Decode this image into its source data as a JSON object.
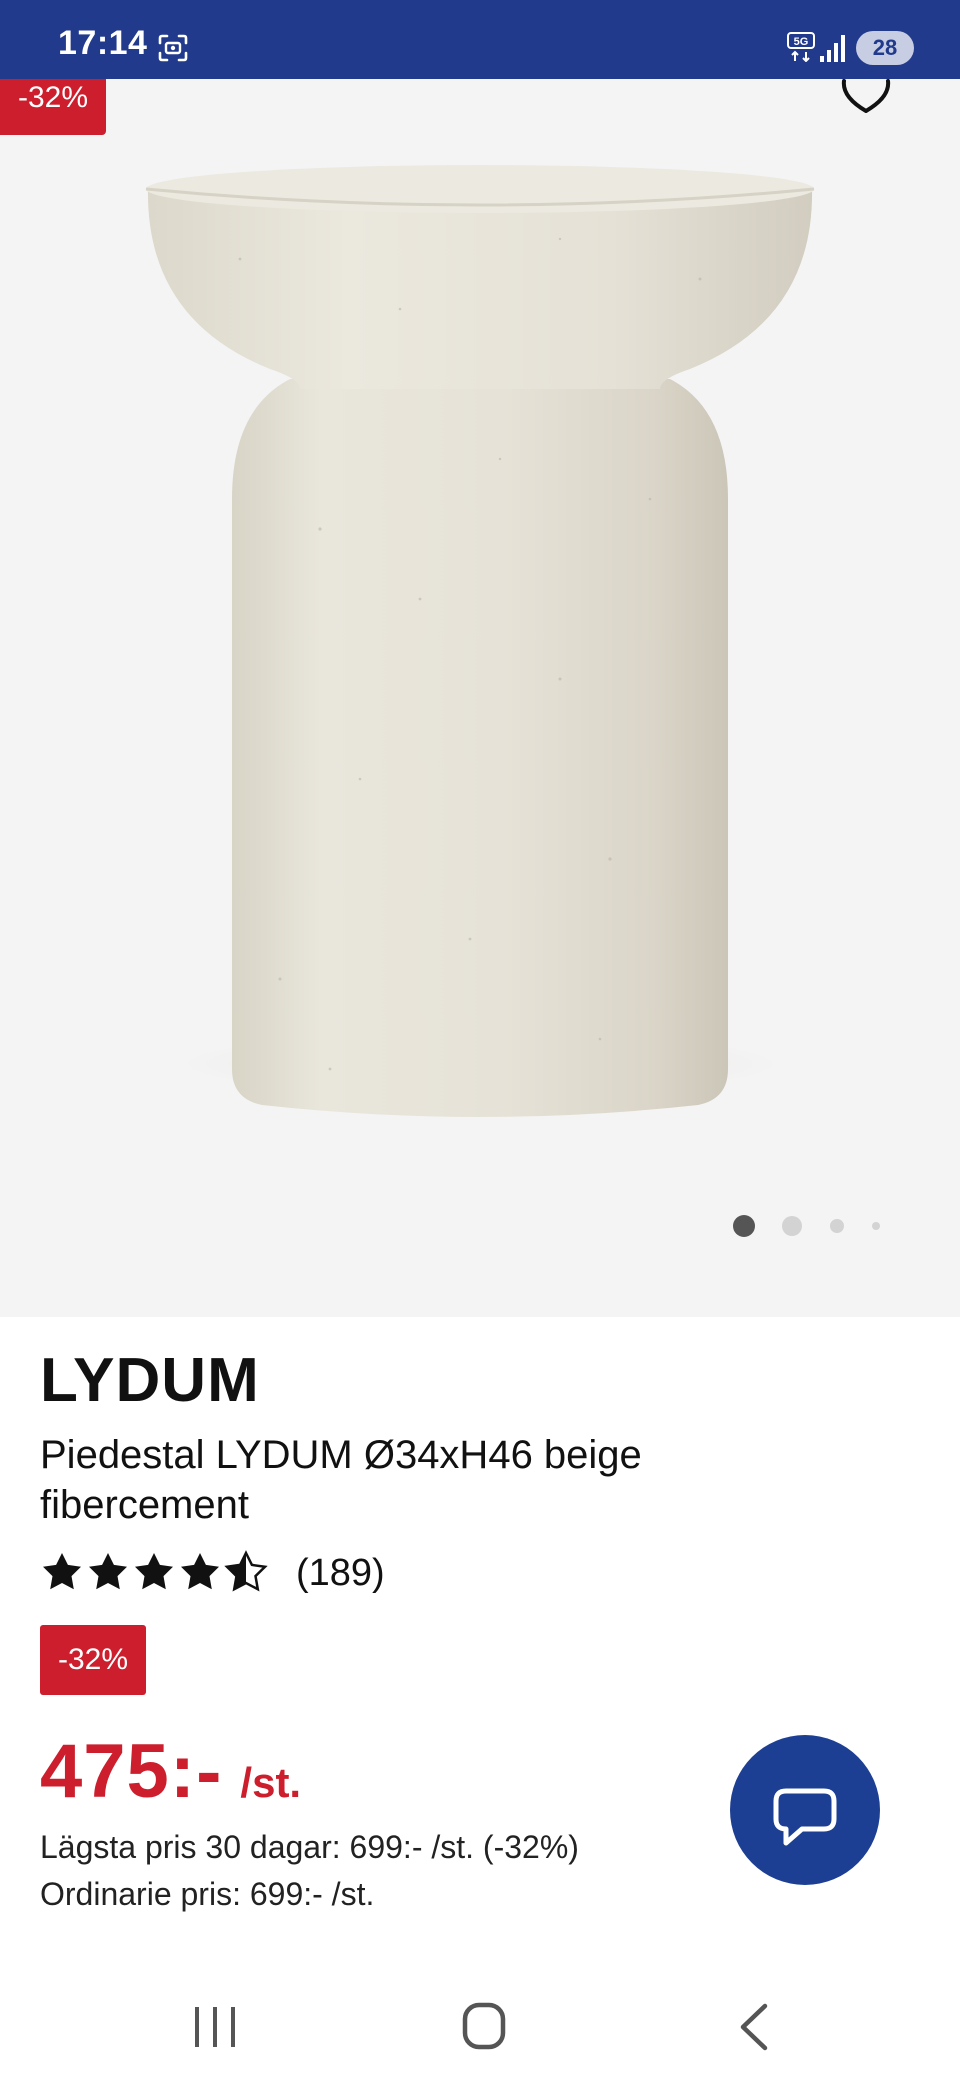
{
  "status_bar": {
    "time": "17:14",
    "battery": "28",
    "icons": [
      "screenshot-icon",
      "5g-network-icon",
      "signal-icon",
      "battery-icon"
    ]
  },
  "gallery": {
    "discount_badge": "-32%",
    "favorite_icon": "heart-outline-icon",
    "page_count": 4,
    "active_page": 1
  },
  "product": {
    "brand": "LYDUM",
    "title": "Piedestal LYDUM Ø34xH46 beige fibercement",
    "rating": 4.5,
    "rating_max": 5,
    "review_count": "(189)",
    "discount_badge": "-32%",
    "price": "475:-",
    "price_unit": "/st.",
    "lowest_price_text": "Lägsta pris 30 dagar: 699:- /st. (-32%)",
    "regular_price_text": "Ordinarie pris: 699:- /st."
  },
  "chat": {
    "icon": "chat-bubble-icon"
  },
  "colors": {
    "brand_blue": "#223a8c",
    "chat_blue": "#1d3f93",
    "sale_red": "#cc1e2c",
    "image_bg": "#f4f4f4",
    "product_beige": "#e4e0d4"
  },
  "nav_bar": {
    "icons": [
      "recents-icon",
      "home-icon",
      "back-icon"
    ]
  }
}
